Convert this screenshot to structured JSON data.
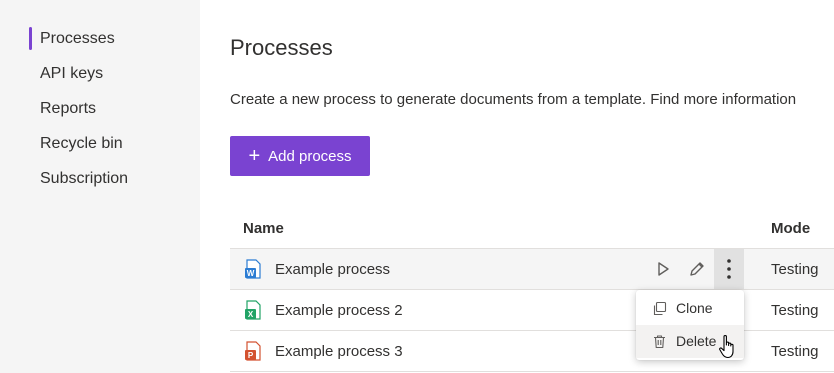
{
  "sidebar": {
    "items": [
      {
        "label": "Processes",
        "active": true
      },
      {
        "label": "API keys",
        "active": false
      },
      {
        "label": "Reports",
        "active": false
      },
      {
        "label": "Recycle bin",
        "active": false
      },
      {
        "label": "Subscription",
        "active": false
      }
    ]
  },
  "main": {
    "title": "Processes",
    "description": "Create a new process to generate documents from a template. Find more information",
    "add_button": {
      "icon": "plus-icon",
      "label": "Add process"
    },
    "table": {
      "columns": [
        "Name",
        "Mode"
      ],
      "rows": [
        {
          "name": "Example process",
          "icon": "word-file-icon",
          "mode": "Testing"
        },
        {
          "name": "Example process 2",
          "icon": "excel-file-icon",
          "mode": "Testing"
        },
        {
          "name": "Example process 3",
          "icon": "powerpoint-file-icon",
          "mode": "Testing"
        }
      ]
    },
    "row_actions": [
      "play-icon",
      "edit-pencil-icon",
      "more-vertical-icon"
    ],
    "context_menu": [
      {
        "label": "Clone",
        "icon": "clone-icon"
      },
      {
        "label": "Delete",
        "icon": "trash-icon"
      }
    ]
  },
  "colors": {
    "accent": "#7a43d1",
    "word": "#2b7cd3",
    "excel": "#21a366",
    "powerpoint": "#d35230"
  }
}
